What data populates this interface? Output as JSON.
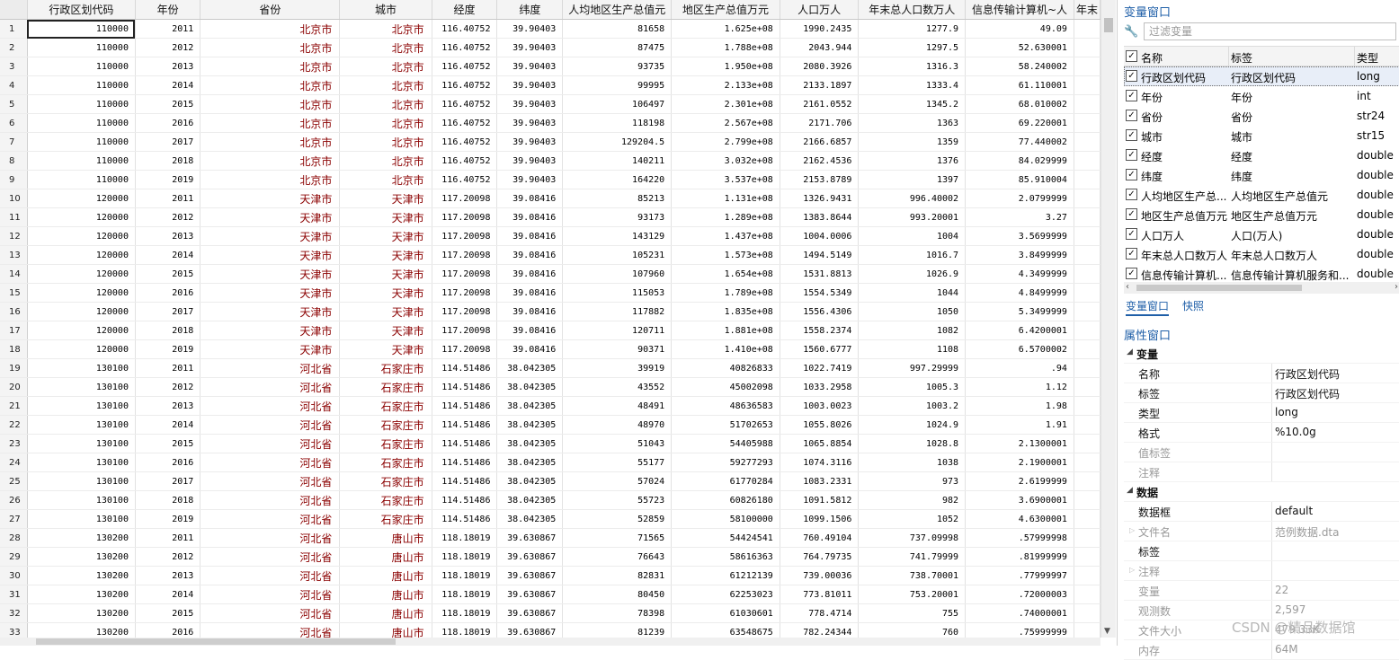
{
  "grid": {
    "columns": [
      "行政区划代码",
      "年份",
      "省份",
      "城市",
      "经度",
      "纬度",
      "人均地区生产总值元",
      "地区生产总值万元",
      "人口万人",
      "年末总人口数万人",
      "信息传输计算机~人",
      "年末"
    ],
    "column_types": [
      "num",
      "num",
      "str",
      "str",
      "num",
      "num",
      "num",
      "num",
      "num",
      "num",
      "num",
      "num"
    ],
    "rows": [
      [
        "1",
        "110000",
        "2011",
        "北京市",
        "北京市",
        "116.40752",
        "39.90403",
        "81658",
        "1.625e+08",
        "1990.2435",
        "1277.9",
        "49.09",
        ""
      ],
      [
        "2",
        "110000",
        "2012",
        "北京市",
        "北京市",
        "116.40752",
        "39.90403",
        "87475",
        "1.788e+08",
        "2043.944",
        "1297.5",
        "52.630001",
        ""
      ],
      [
        "3",
        "110000",
        "2013",
        "北京市",
        "北京市",
        "116.40752",
        "39.90403",
        "93735",
        "1.950e+08",
        "2080.3926",
        "1316.3",
        "58.240002",
        ""
      ],
      [
        "4",
        "110000",
        "2014",
        "北京市",
        "北京市",
        "116.40752",
        "39.90403",
        "99995",
        "2.133e+08",
        "2133.1897",
        "1333.4",
        "61.110001",
        ""
      ],
      [
        "5",
        "110000",
        "2015",
        "北京市",
        "北京市",
        "116.40752",
        "39.90403",
        "106497",
        "2.301e+08",
        "2161.0552",
        "1345.2",
        "68.010002",
        ""
      ],
      [
        "6",
        "110000",
        "2016",
        "北京市",
        "北京市",
        "116.40752",
        "39.90403",
        "118198",
        "2.567e+08",
        "2171.706",
        "1363",
        "69.220001",
        ""
      ],
      [
        "7",
        "110000",
        "2017",
        "北京市",
        "北京市",
        "116.40752",
        "39.90403",
        "129204.5",
        "2.799e+08",
        "2166.6857",
        "1359",
        "77.440002",
        ""
      ],
      [
        "8",
        "110000",
        "2018",
        "北京市",
        "北京市",
        "116.40752",
        "39.90403",
        "140211",
        "3.032e+08",
        "2162.4536",
        "1376",
        "84.029999",
        ""
      ],
      [
        "9",
        "110000",
        "2019",
        "北京市",
        "北京市",
        "116.40752",
        "39.90403",
        "164220",
        "3.537e+08",
        "2153.8789",
        "1397",
        "85.910004",
        ""
      ],
      [
        "10",
        "120000",
        "2011",
        "天津市",
        "天津市",
        "117.20098",
        "39.08416",
        "85213",
        "1.131e+08",
        "1326.9431",
        "996.40002",
        "2.0799999",
        ""
      ],
      [
        "11",
        "120000",
        "2012",
        "天津市",
        "天津市",
        "117.20098",
        "39.08416",
        "93173",
        "1.289e+08",
        "1383.8644",
        "993.20001",
        "3.27",
        ""
      ],
      [
        "12",
        "120000",
        "2013",
        "天津市",
        "天津市",
        "117.20098",
        "39.08416",
        "143129",
        "1.437e+08",
        "1004.0006",
        "1004",
        "3.5699999",
        ""
      ],
      [
        "13",
        "120000",
        "2014",
        "天津市",
        "天津市",
        "117.20098",
        "39.08416",
        "105231",
        "1.573e+08",
        "1494.5149",
        "1016.7",
        "3.8499999",
        ""
      ],
      [
        "14",
        "120000",
        "2015",
        "天津市",
        "天津市",
        "117.20098",
        "39.08416",
        "107960",
        "1.654e+08",
        "1531.8813",
        "1026.9",
        "4.3499999",
        ""
      ],
      [
        "15",
        "120000",
        "2016",
        "天津市",
        "天津市",
        "117.20098",
        "39.08416",
        "115053",
        "1.789e+08",
        "1554.5349",
        "1044",
        "4.8499999",
        ""
      ],
      [
        "16",
        "120000",
        "2017",
        "天津市",
        "天津市",
        "117.20098",
        "39.08416",
        "117882",
        "1.835e+08",
        "1556.4306",
        "1050",
        "5.3499999",
        ""
      ],
      [
        "17",
        "120000",
        "2018",
        "天津市",
        "天津市",
        "117.20098",
        "39.08416",
        "120711",
        "1.881e+08",
        "1558.2374",
        "1082",
        "6.4200001",
        ""
      ],
      [
        "18",
        "120000",
        "2019",
        "天津市",
        "天津市",
        "117.20098",
        "39.08416",
        "90371",
        "1.410e+08",
        "1560.6777",
        "1108",
        "6.5700002",
        ""
      ],
      [
        "19",
        "130100",
        "2011",
        "河北省",
        "石家庄市",
        "114.51486",
        "38.042305",
        "39919",
        "40826833",
        "1022.7419",
        "997.29999",
        ".94",
        ""
      ],
      [
        "20",
        "130100",
        "2012",
        "河北省",
        "石家庄市",
        "114.51486",
        "38.042305",
        "43552",
        "45002098",
        "1033.2958",
        "1005.3",
        "1.12",
        ""
      ],
      [
        "21",
        "130100",
        "2013",
        "河北省",
        "石家庄市",
        "114.51486",
        "38.042305",
        "48491",
        "48636583",
        "1003.0023",
        "1003.2",
        "1.98",
        ""
      ],
      [
        "22",
        "130100",
        "2014",
        "河北省",
        "石家庄市",
        "114.51486",
        "38.042305",
        "48970",
        "51702653",
        "1055.8026",
        "1024.9",
        "1.91",
        ""
      ],
      [
        "23",
        "130100",
        "2015",
        "河北省",
        "石家庄市",
        "114.51486",
        "38.042305",
        "51043",
        "54405988",
        "1065.8854",
        "1028.8",
        "2.1300001",
        ""
      ],
      [
        "24",
        "130100",
        "2016",
        "河北省",
        "石家庄市",
        "114.51486",
        "38.042305",
        "55177",
        "59277293",
        "1074.3116",
        "1038",
        "2.1900001",
        ""
      ],
      [
        "25",
        "130100",
        "2017",
        "河北省",
        "石家庄市",
        "114.51486",
        "38.042305",
        "57024",
        "61770284",
        "1083.2331",
        "973",
        "2.6199999",
        ""
      ],
      [
        "26",
        "130100",
        "2018",
        "河北省",
        "石家庄市",
        "114.51486",
        "38.042305",
        "55723",
        "60826180",
        "1091.5812",
        "982",
        "3.6900001",
        ""
      ],
      [
        "27",
        "130100",
        "2019",
        "河北省",
        "石家庄市",
        "114.51486",
        "38.042305",
        "52859",
        "58100000",
        "1099.1506",
        "1052",
        "4.6300001",
        ""
      ],
      [
        "28",
        "130200",
        "2011",
        "河北省",
        "唐山市",
        "118.18019",
        "39.630867",
        "71565",
        "54424541",
        "760.49104",
        "737.09998",
        ".57999998",
        ""
      ],
      [
        "29",
        "130200",
        "2012",
        "河北省",
        "唐山市",
        "118.18019",
        "39.630867",
        "76643",
        "58616363",
        "764.79735",
        "741.79999",
        ".81999999",
        ""
      ],
      [
        "30",
        "130200",
        "2013",
        "河北省",
        "唐山市",
        "118.18019",
        "39.630867",
        "82831",
        "61212139",
        "739.00036",
        "738.70001",
        ".77999997",
        ""
      ],
      [
        "31",
        "130200",
        "2014",
        "河北省",
        "唐山市",
        "118.18019",
        "39.630867",
        "80450",
        "62253023",
        "773.81011",
        "753.20001",
        ".72000003",
        ""
      ],
      [
        "32",
        "130200",
        "2015",
        "河北省",
        "唐山市",
        "118.18019",
        "39.630867",
        "78398",
        "61030601",
        "778.4714",
        "755",
        ".74000001",
        ""
      ],
      [
        "33",
        "130200",
        "2016",
        "河北省",
        "唐山市",
        "118.18019",
        "39.630867",
        "81239",
        "63548675",
        "782.24344",
        "760",
        ".75999999",
        ""
      ]
    ]
  },
  "variables_window": {
    "title": "变量窗口",
    "filter_placeholder": "过滤变量",
    "headers": {
      "name": "名称",
      "label": "标签",
      "type": "类型"
    },
    "items": [
      {
        "name": "行政区划代码",
        "label": "行政区划代码",
        "type": "long"
      },
      {
        "name": "年份",
        "label": "年份",
        "type": "int"
      },
      {
        "name": "省份",
        "label": "省份",
        "type": "str24"
      },
      {
        "name": "城市",
        "label": "城市",
        "type": "str15"
      },
      {
        "name": "经度",
        "label": "经度",
        "type": "double"
      },
      {
        "name": "纬度",
        "label": "纬度",
        "type": "double"
      },
      {
        "name": "人均地区生产总...",
        "label": "人均地区生产总值元",
        "type": "double"
      },
      {
        "name": "地区生产总值万元",
        "label": "地区生产总值万元",
        "type": "double"
      },
      {
        "name": "人口万人",
        "label": "人口(万人)",
        "type": "double"
      },
      {
        "name": "年末总人口数万人",
        "label": "年末总人口数万人",
        "type": "double"
      },
      {
        "name": "信息传输计算机...",
        "label": "信息传输计算机服务和...",
        "type": "double"
      }
    ],
    "tabs": [
      "变量窗口",
      "快照"
    ]
  },
  "properties_window": {
    "title": "属性窗口",
    "variable_group": "变量",
    "variable_props": [
      {
        "key": "名称",
        "value": "行政区划代码"
      },
      {
        "key": "标签",
        "value": "行政区划代码"
      },
      {
        "key": "类型",
        "value": "long"
      },
      {
        "key": "格式",
        "value": "%10.0g"
      },
      {
        "key": "值标签",
        "value": ""
      },
      {
        "key": "注释",
        "value": ""
      }
    ],
    "data_group": "数据",
    "data_props": [
      {
        "key": "数据框",
        "value": "default"
      },
      {
        "key": "文件名",
        "value": "范例数据.dta"
      },
      {
        "key": "标签",
        "value": ""
      },
      {
        "key": "注释",
        "value": ""
      },
      {
        "key": "变量",
        "value": "22"
      },
      {
        "key": "观测数",
        "value": "2,597"
      },
      {
        "key": "文件大小",
        "value": "479.33K"
      },
      {
        "key": "内存",
        "value": "64M"
      }
    ]
  },
  "watermark": "CSDN @精品数据馆"
}
